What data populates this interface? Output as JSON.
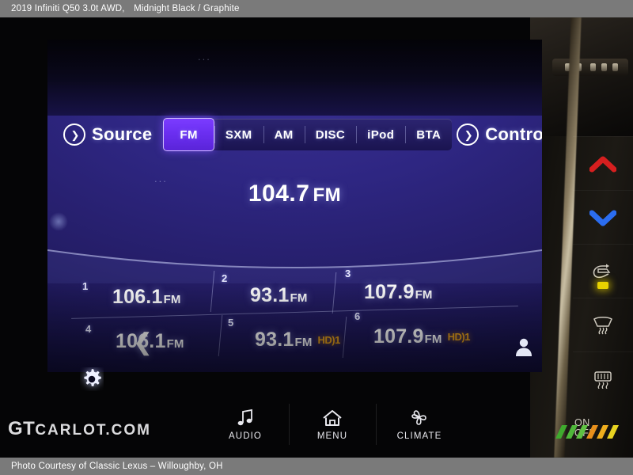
{
  "caption_top": {
    "vehicle": "2019 Infiniti Q50 3.0t AWD,",
    "colors": "Midnight Black / Graphite"
  },
  "caption_bottom": {
    "text": "Photo Courtesy of Classic Lexus – Willoughby, OH"
  },
  "watermark": {
    "prefix": "GT",
    "suffix": "CARLOT.COM"
  },
  "head_unit": {
    "source_button": {
      "label": "Source",
      "icon": "chevron-circle-right-icon"
    },
    "control_button": {
      "label": "Control",
      "icon": "chevron-circle-right-icon"
    },
    "tabs": [
      {
        "label": "FM",
        "active": true
      },
      {
        "label": "SXM",
        "active": false
      },
      {
        "label": "AM",
        "active": false
      },
      {
        "label": "DISC",
        "active": false
      },
      {
        "label": "iPod",
        "active": false
      },
      {
        "label": "BTA",
        "active": false
      }
    ],
    "now_playing": {
      "frequency": "104.7",
      "band": "FM"
    },
    "presets": [
      {
        "number": "1",
        "frequency": "106.1",
        "band": "FM",
        "hd": ""
      },
      {
        "number": "2",
        "frequency": "93.1",
        "band": "FM",
        "hd": ""
      },
      {
        "number": "3",
        "frequency": "107.9",
        "band": "FM",
        "hd": ""
      },
      {
        "number": "4",
        "frequency": "106.1",
        "band": "FM",
        "hd": ""
      },
      {
        "number": "5",
        "frequency": "93.1",
        "band": "FM",
        "hd": "HD)1"
      },
      {
        "number": "6",
        "frequency": "107.9",
        "band": "FM",
        "hd": "HD)1"
      }
    ],
    "prev_page_icon": "chevron-left-icon",
    "next_page_icon": "chevron-right-icon",
    "page_dots": {
      "count": 6,
      "active_index": 0
    },
    "settings_icon": "gear-icon",
    "user_icon": "person-icon",
    "faint_marks": "..."
  },
  "soft_keys": [
    {
      "label": "AUDIO",
      "icon": "music-note-icon"
    },
    {
      "label": "MENU",
      "icon": "home-icon"
    },
    {
      "label": "CLIMATE",
      "icon": "fan-icon"
    }
  ],
  "console_buttons": [
    {
      "name": "temp-up",
      "icon": "chevron-up-icon",
      "color": "#d61f1f"
    },
    {
      "name": "temp-down",
      "icon": "chevron-down-icon",
      "color": "#2b6df0"
    },
    {
      "name": "recirculate",
      "icon": "recirculate-icon",
      "color": "#cfcabf",
      "led": "#e8d100"
    },
    {
      "name": "front-defrost",
      "icon": "windshield-defrost-icon",
      "color": "#cfcabf"
    },
    {
      "name": "rear-defrost",
      "icon": "rear-defrost-icon",
      "color": "#cfcabf"
    }
  ],
  "power_button": {
    "line1": "ON",
    "line2": "OFF"
  },
  "colors": {
    "accent_purple": "#6a2ef0",
    "screen_blue": "#2e2682",
    "hd_amber": "#e8a11c",
    "caption_bar": "#7a7a7a"
  }
}
